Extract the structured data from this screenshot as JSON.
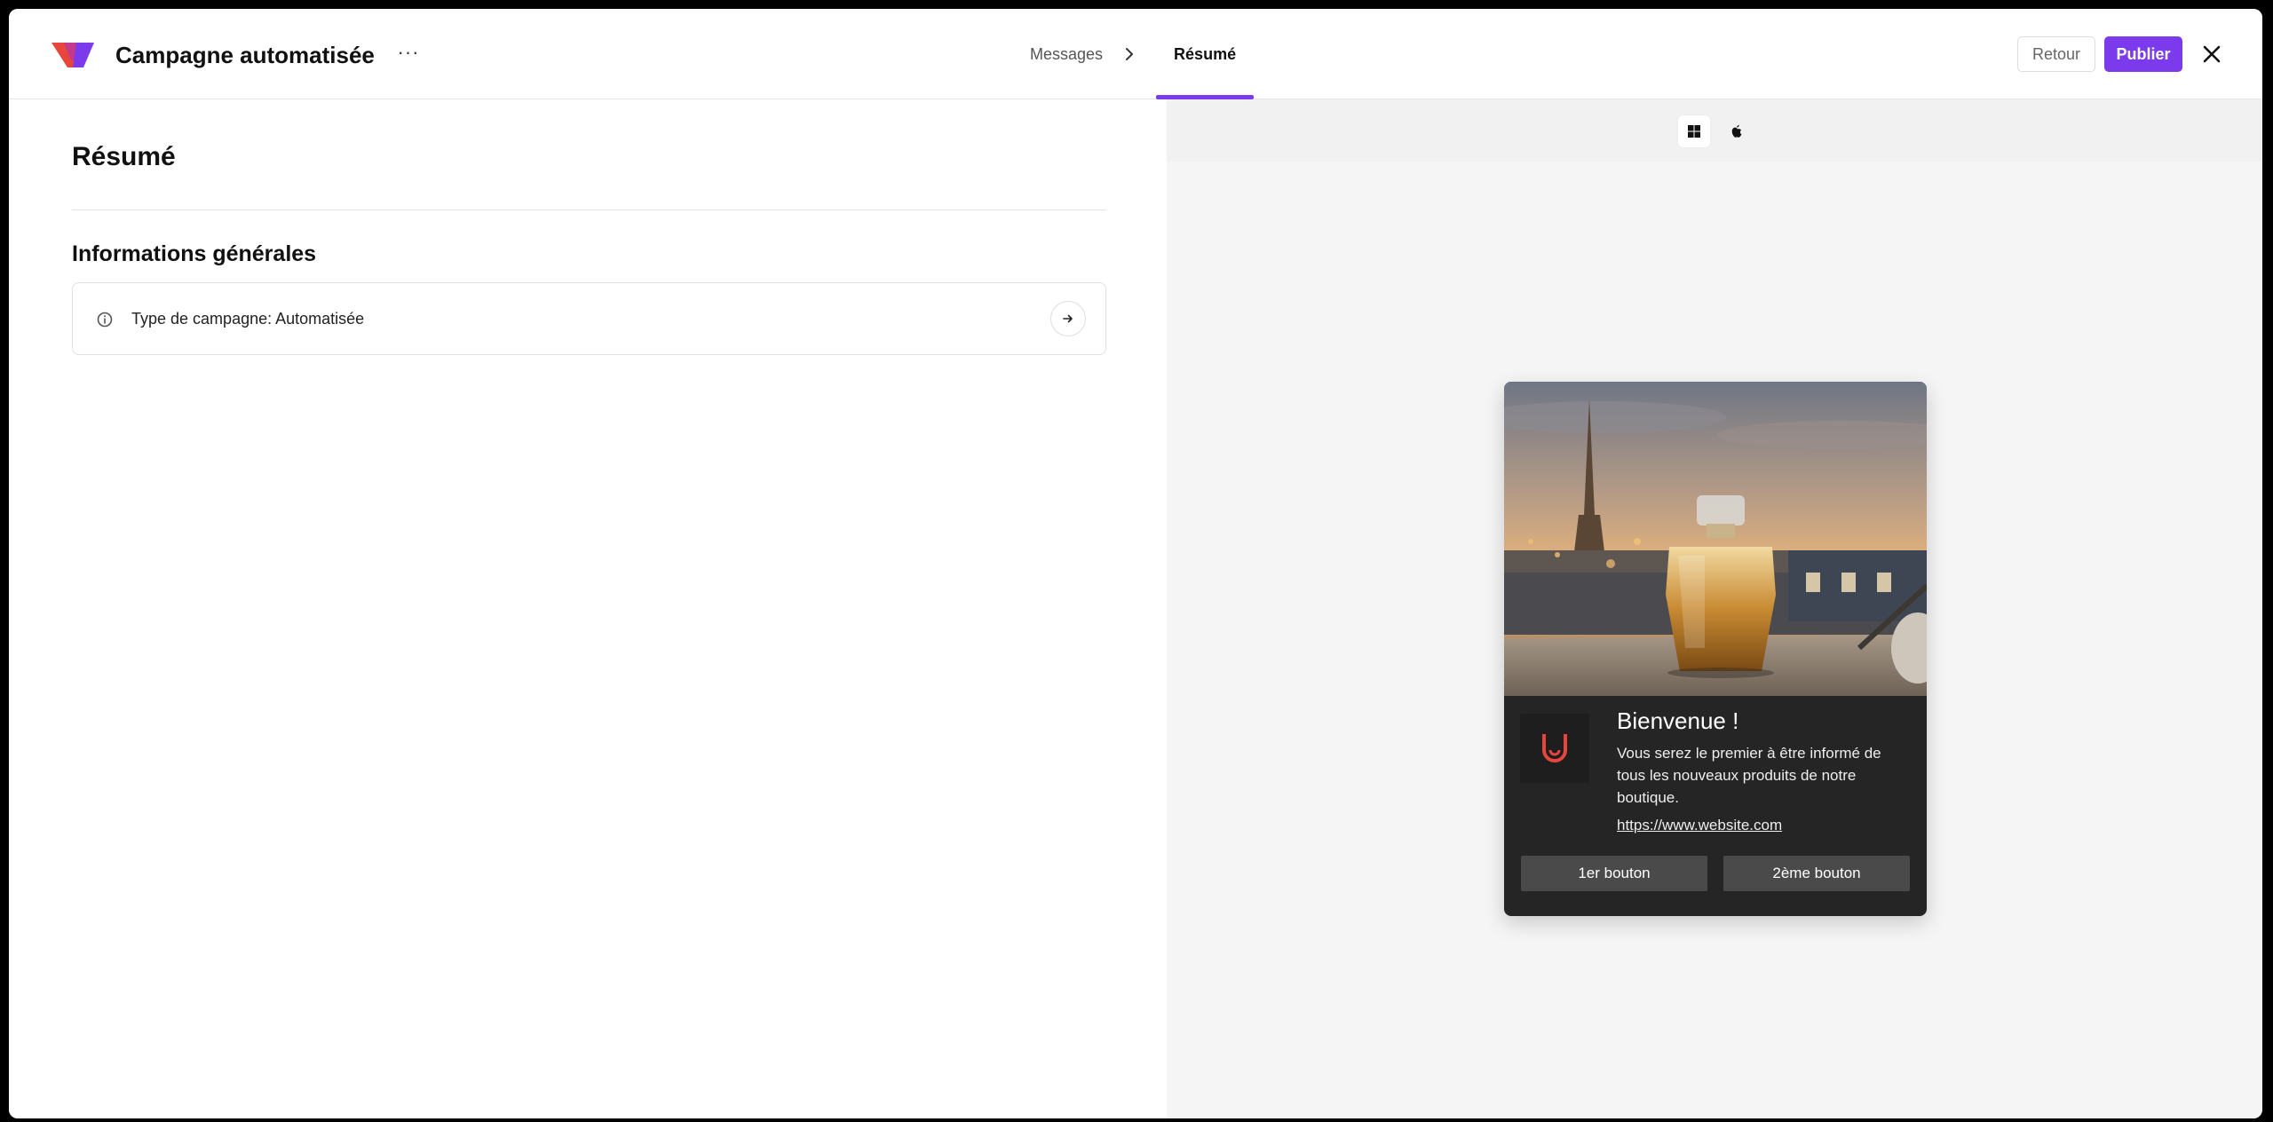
{
  "header": {
    "app_title": "Campagne automatisée",
    "more_label": "···",
    "steps": [
      {
        "label": "Messages"
      },
      {
        "label": "Résumé"
      }
    ],
    "retour_label": "Retour",
    "publier_label": "Publier"
  },
  "summary": {
    "page_title": "Résumé",
    "section_title": "Informations générales",
    "campaign_type_text": "Type de campagne: Automatisée"
  },
  "preview": {
    "os_options": [
      "windows-icon",
      "apple-icon"
    ],
    "selected_os": "windows",
    "notification": {
      "title": "Bienvenue !",
      "body": "Vous serez le premier à être informé de tous les nouveaux produits de notre boutique.",
      "link": "https://www.website.com",
      "button1": "1er bouton",
      "button2": "2ème bouton"
    }
  },
  "colors": {
    "accent": "#7c3aed",
    "notification_bg": "#252526",
    "notification_button": "#4a4a4b",
    "app_icon_accent": "#e8453c"
  }
}
